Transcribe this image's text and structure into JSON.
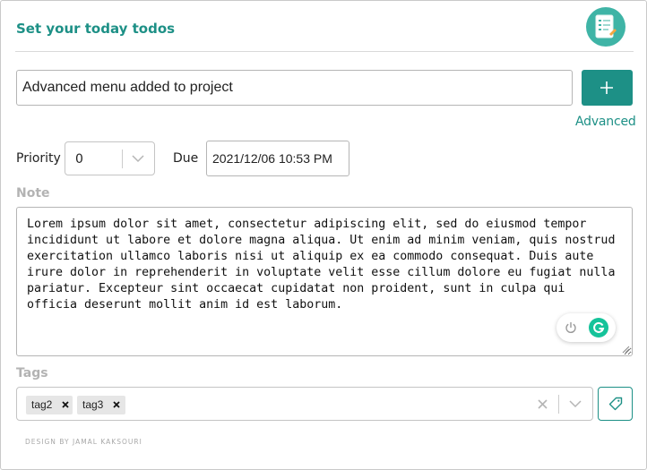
{
  "header": {
    "title": "Set your today todos",
    "logo_icon": "todo-list-icon"
  },
  "todo": {
    "value": "Advanced menu added to project",
    "add_icon": "plus-icon"
  },
  "advanced": {
    "label": "Advanced"
  },
  "priority": {
    "label": "Priority",
    "selected": "0"
  },
  "due": {
    "label": "Due",
    "value": "2021/12/06 10:53 PM"
  },
  "note": {
    "label": "Note",
    "value": "Lorem ipsum dolor sit amet, consectetur adipiscing elit, sed do eiusmod tempor incididunt ut labore et dolore magna aliqua. Ut enim ad minim veniam, quis nostrud exercitation ullamco laboris nisi ut aliquip ex ea commodo consequat. Duis aute irure dolor in reprehenderit in voluptate velit esse cillum dolore eu fugiat nulla pariatur. Excepteur sint occaecat cupidatat non proident, sunt in culpa qui officia deserunt mollit anim id est laborum."
  },
  "tags": {
    "label": "Tags",
    "items": [
      "tag2",
      "tag3"
    ]
  },
  "footer": {
    "credit": "DESIGN BY JAMAL KAKSOURI"
  },
  "colors": {
    "accent": "#1d9086",
    "logo_bg": "#3fb4a6",
    "muted_label": "#b3b3b3",
    "grammarly": "#15c39a"
  }
}
